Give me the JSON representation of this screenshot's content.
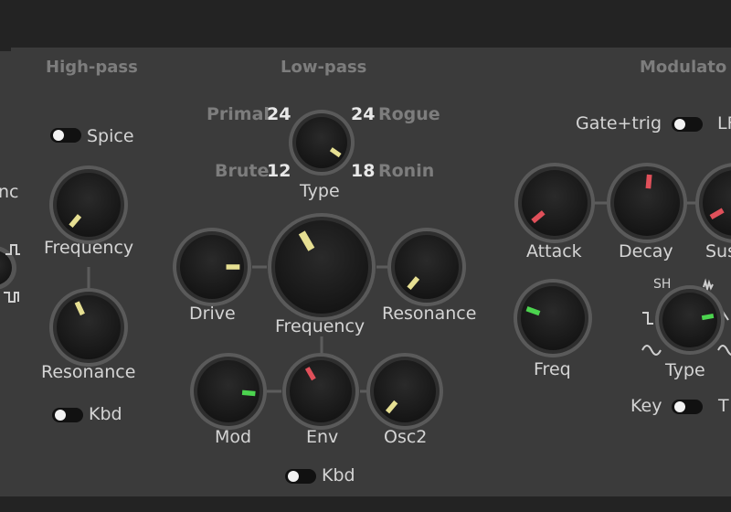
{
  "sections": {
    "highpass": "High-pass",
    "lowpass": "Low-pass",
    "modulator": "Modulato"
  },
  "left_partial": {
    "label": "nc"
  },
  "highpass": {
    "toggle_label": "Spice",
    "frequency_label": "Frequency",
    "resonance_label": "Resonance",
    "kbd_label": "Kbd"
  },
  "lowpass": {
    "type_options": {
      "top_left_name": "Primal",
      "top_left_value": "24",
      "top_right_value": "24",
      "top_right_name": "Rogue",
      "bottom_left_name": "Brute",
      "bottom_left_value": "12",
      "bottom_right_value": "18",
      "bottom_right_name": "Ronin"
    },
    "type_label": "Type",
    "drive_label": "Drive",
    "frequency_label": "Frequency",
    "resonance_label": "Resonance",
    "mod_label": "Mod",
    "env_label": "Env",
    "osc2_label": "Osc2",
    "kbd_label": "Kbd"
  },
  "modulator": {
    "toggle_left_label": "Gate+trig",
    "toggle_right_label": "LF",
    "attack_label": "Attack",
    "decay_label": "Decay",
    "sustain_label": "Sus",
    "freq_label": "Freq",
    "type_label": "Type",
    "type_sh_label": "SH",
    "key_label": "Key",
    "key_right_label": "T"
  },
  "indicator_colors": {
    "yellow": "#e6df92",
    "green": "#4cd44f",
    "red": "#e0505a"
  }
}
